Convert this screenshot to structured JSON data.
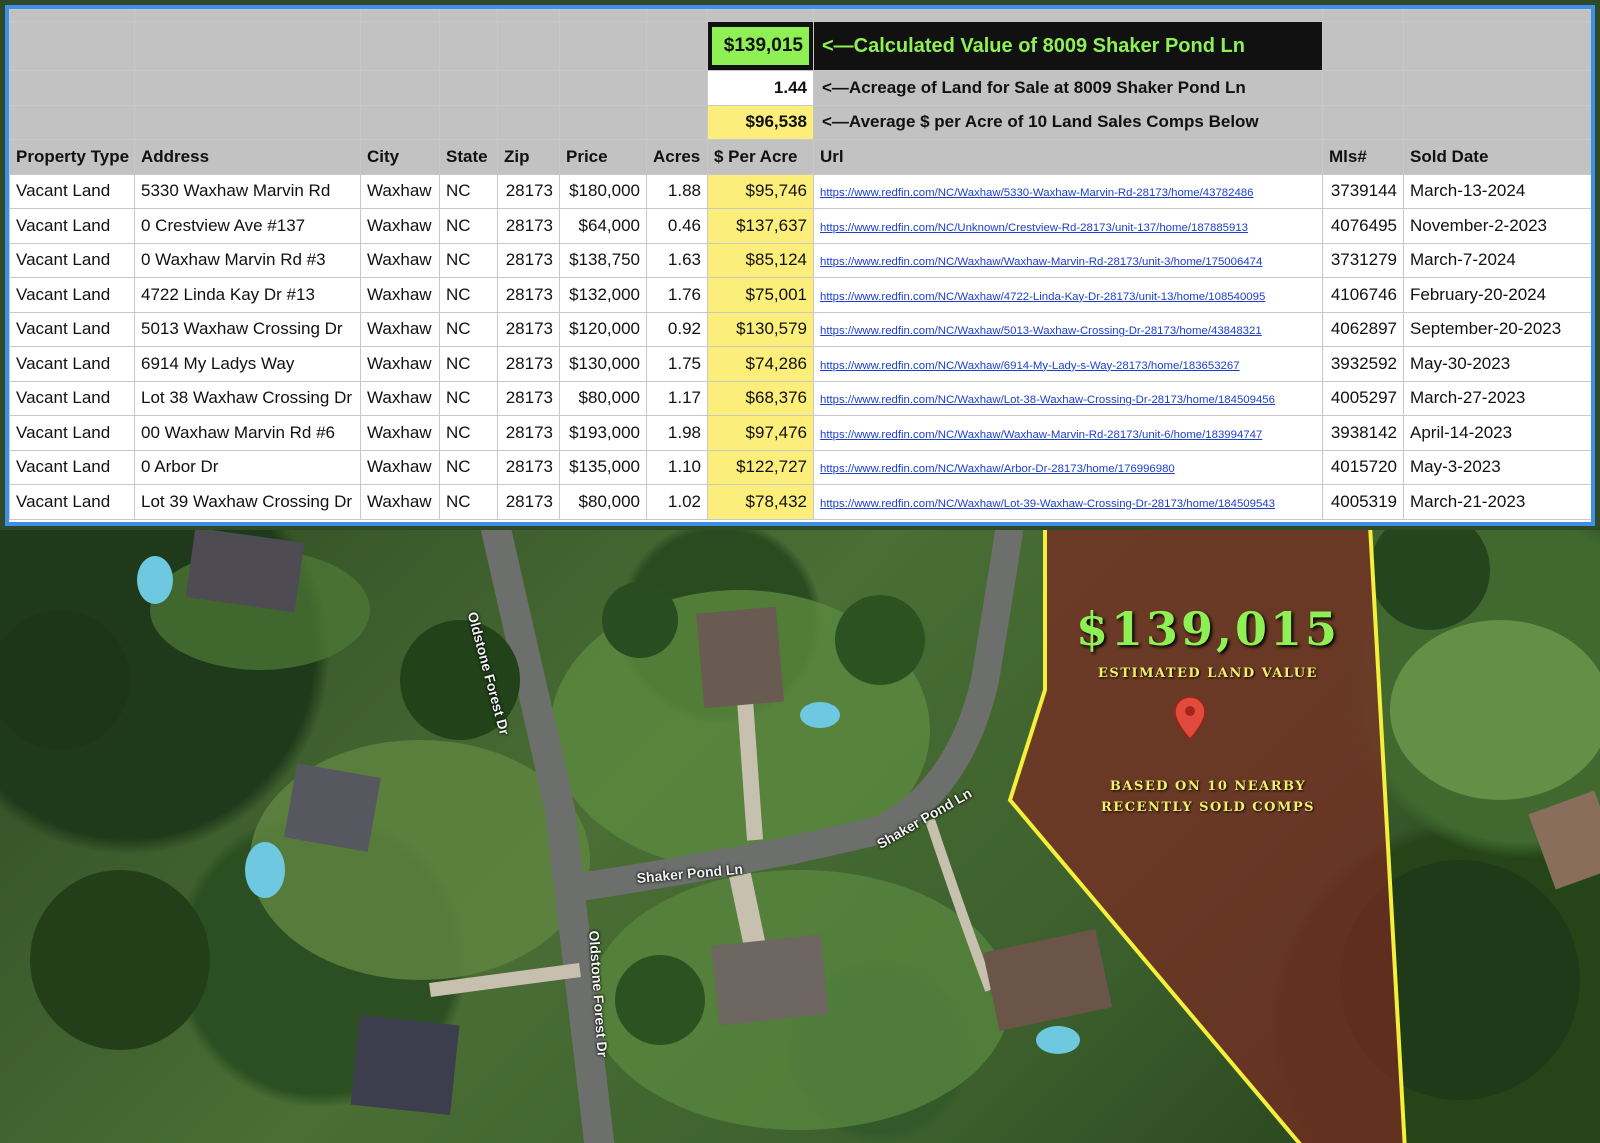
{
  "summary": {
    "calculated_value": "$139,015",
    "calculated_label": "<—Calculated Value of 8009 Shaker Pond Ln",
    "acreage_value": "1.44",
    "acreage_label": "<—Acreage of Land for Sale at 8009 Shaker Pond Ln",
    "avg_value": "$96,538",
    "avg_label": "<—Average $ per Acre of 10 Land Sales Comps Below"
  },
  "table": {
    "headers": [
      "Property Type",
      "Address",
      "City",
      "State",
      "Zip",
      "Price",
      "Acres",
      "$ Per Acre",
      "Url",
      "Mls#",
      "Sold Date"
    ],
    "rows": [
      [
        "Vacant Land",
        "5330 Waxhaw Marvin Rd",
        "Waxhaw",
        "NC",
        "28173",
        "$180,000",
        "1.88",
        "$95,746",
        "https://www.redfin.com/NC/Waxhaw/5330-Waxhaw-Marvin-Rd-28173/home/43782486",
        "3739144",
        "March-13-2024"
      ],
      [
        "Vacant Land",
        "0 Crestview Ave #137",
        "Waxhaw",
        "NC",
        "28173",
        "$64,000",
        "0.46",
        "$137,637",
        "https://www.redfin.com/NC/Unknown/Crestview-Rd-28173/unit-137/home/187885913",
        "4076495",
        "November-2-2023"
      ],
      [
        "Vacant Land",
        "0 Waxhaw Marvin Rd #3",
        "Waxhaw",
        "NC",
        "28173",
        "$138,750",
        "1.63",
        "$85,124",
        "https://www.redfin.com/NC/Waxhaw/Waxhaw-Marvin-Rd-28173/unit-3/home/175006474",
        "3731279",
        "March-7-2024"
      ],
      [
        "Vacant Land",
        "4722 Linda Kay Dr #13",
        "Waxhaw",
        "NC",
        "28173",
        "$132,000",
        "1.76",
        "$75,001",
        "https://www.redfin.com/NC/Waxhaw/4722-Linda-Kay-Dr-28173/unit-13/home/108540095",
        "4106746",
        "February-20-2024"
      ],
      [
        "Vacant Land",
        "5013 Waxhaw Crossing Dr",
        "Waxhaw",
        "NC",
        "28173",
        "$120,000",
        "0.92",
        "$130,579",
        "https://www.redfin.com/NC/Waxhaw/5013-Waxhaw-Crossing-Dr-28173/home/43848321",
        "4062897",
        "September-20-2023"
      ],
      [
        "Vacant Land",
        "6914 My Ladys Way",
        "Waxhaw",
        "NC",
        "28173",
        "$130,000",
        "1.75",
        "$74,286",
        "https://www.redfin.com/NC/Waxhaw/6914-My-Lady-s-Way-28173/home/183653267",
        "3932592",
        "May-30-2023"
      ],
      [
        "Vacant Land",
        "Lot 38 Waxhaw Crossing Dr",
        "Waxhaw",
        "NC",
        "28173",
        "$80,000",
        "1.17",
        "$68,376",
        "https://www.redfin.com/NC/Waxhaw/Lot-38-Waxhaw-Crossing-Dr-28173/home/184509456",
        "4005297",
        "March-27-2023"
      ],
      [
        "Vacant Land",
        "00 Waxhaw Marvin Rd #6",
        "Waxhaw",
        "NC",
        "28173",
        "$193,000",
        "1.98",
        "$97,476",
        "https://www.redfin.com/NC/Waxhaw/Waxhaw-Marvin-Rd-28173/unit-6/home/183994747",
        "3938142",
        "April-14-2023"
      ],
      [
        "Vacant Land",
        "0 Arbor Dr",
        "Waxhaw",
        "NC",
        "28173",
        "$135,000",
        "1.10",
        "$122,727",
        "https://www.redfin.com/NC/Waxhaw/Arbor-Dr-28173/home/176996980",
        "4015720",
        "May-3-2023"
      ],
      [
        "Vacant Land",
        "Lot 39 Waxhaw Crossing Dr",
        "Waxhaw",
        "NC",
        "28173",
        "$80,000",
        "1.02",
        "$78,432",
        "https://www.redfin.com/NC/Waxhaw/Lot-39-Waxhaw-Crossing-Dr-28173/home/184509543",
        "4005319",
        "March-21-2023"
      ]
    ]
  },
  "map": {
    "road_labels": {
      "oldstone_top": "Oldstone Forest Dr",
      "oldstone_bottom": "Oldstone Forest Dr",
      "shaker_left": "Shaker Pond Ln",
      "shaker_right": "Shaker Pond Ln"
    },
    "overlay": {
      "value": "$139,015",
      "value_caption": "ESTIMATED LAND VALUE",
      "basis_line1": "BASED ON 10 NEARBY",
      "basis_line2": "RECENTLY SOLD COMPS"
    },
    "icons": {
      "pin": "map-pin-icon"
    },
    "colors": {
      "boundary": "#f4ef3a",
      "value_green": "#8ef055",
      "caption_yellow": "#f4ef6a"
    }
  }
}
